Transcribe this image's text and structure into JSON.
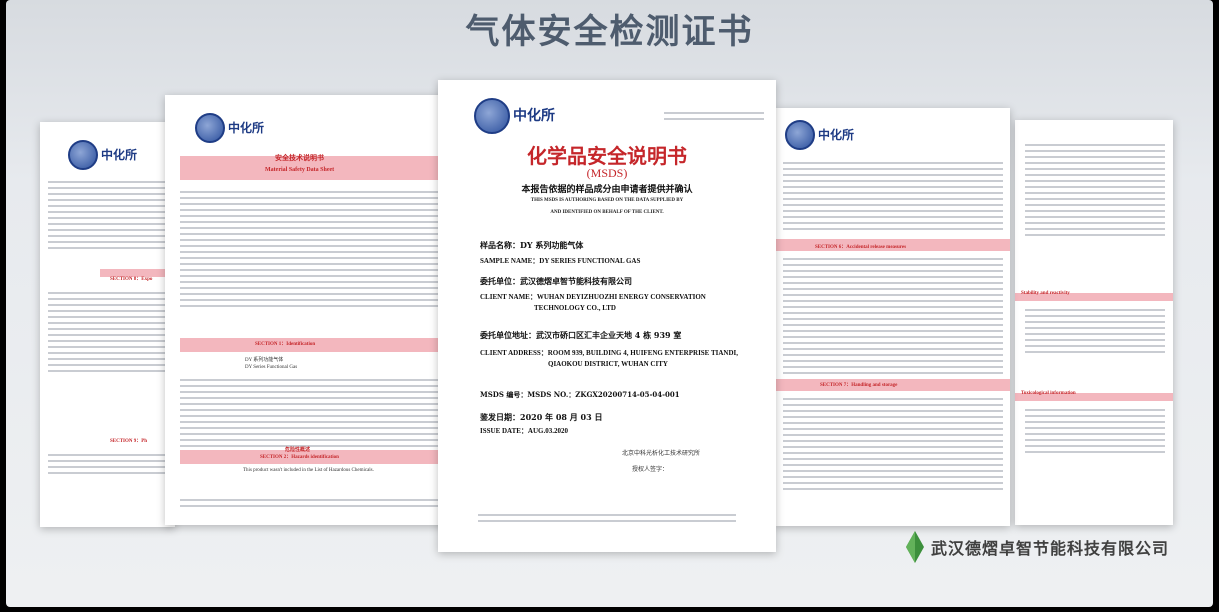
{
  "header_title": "气体安全检测证书",
  "company_name": "武汉德熠卓智节能科技有限公司",
  "logo_text": "中化所",
  "center_doc": {
    "cn_title": "化学品安全说明书",
    "sub_title": "(MSDS)",
    "subtitle_cn": "本报告依据的样品成分由申请者提供并确认",
    "subtitle_en_1": "THIS MSDS IS AUTHORING BASED ON THE DATA SUPPLIED BY",
    "subtitle_en_2": "AND IDENTIFIED ON BEHALF OF THE CLIENT.",
    "sample_cn": "样品名称：DY 系列功能气体",
    "sample_en": "SAMPLE NAME：DY SERIES FUNCTIONAL GAS",
    "client_cn": "委托单位：武汉德熠卓智节能科技有限公司",
    "client_en_1": "CLIENT NAME：WUHAN DEYIZHUOZHI ENERGY CONSERVATION",
    "client_en_2": "TECHNOLOGY CO., LTD",
    "address_cn": "委托单位地址：武汉市硚口区汇丰企业天地 4 栋 939 室",
    "address_en_1": "CLIENT ADDRESS：ROOM 939, BUILDING 4, HUIFENG ENTERPRISE TIANDI,",
    "address_en_2": "QIAOKOU DISTRICT, WUHAN CITY",
    "msds_no": "MSDS 编号：MSDS NO.：ZKGX20200714-05-04-001",
    "issue_cn": "鉴发日期：2020 年 08 月 03 日",
    "issue_en": "ISSUE DATE：AUG.03.2020",
    "institute": "北京中科光析化工技术研究所",
    "signatory": "授权人签字："
  },
  "left2_doc": {
    "pink_title": "安全技术说明书",
    "pink_sub": "Material Safety Data Sheet",
    "section1": "SECTION 1：Identification",
    "section2": "SECTION 2：Hazards identification",
    "hazard_cn": "危险性概述",
    "product_name": "DY 系列功能气体",
    "product_en": "DY Series Functional Gas",
    "hazard_text": "This product wasn't included in the List of Hazardous Chemicals."
  },
  "right2_doc": {
    "section6": "SECTION 6：Accidental release measures",
    "section7": "SECTION 7：Handling and storage"
  },
  "left1_doc": {
    "section8": "SECTION 8：Expo",
    "section9": "SECTION 9：Ph"
  },
  "right1_doc": {
    "section10": "Stability and reactivity",
    "section11": "Toxicological information"
  },
  "colors": {
    "title": "#4e5c6e",
    "pink": "#f3b7be",
    "red": "#c5262a",
    "navy": "#1d3a84"
  }
}
